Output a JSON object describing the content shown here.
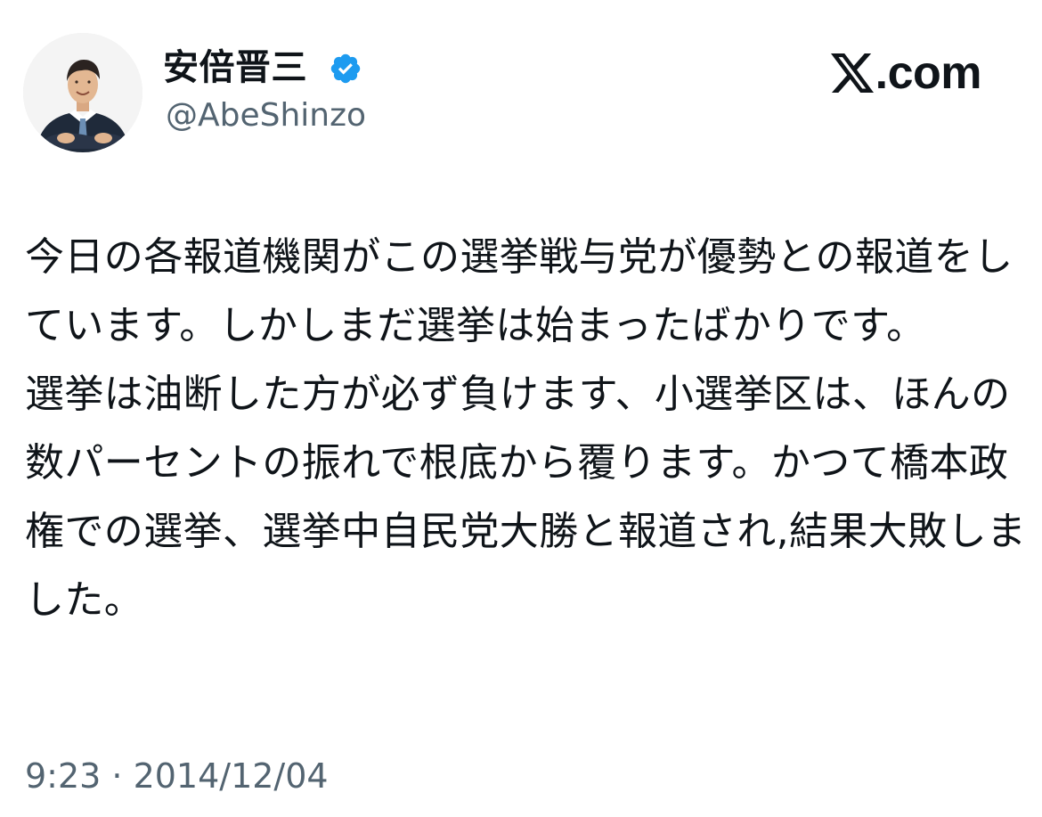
{
  "author": {
    "display_name": "安倍晋三",
    "handle": "@AbeShinzo",
    "verified": true,
    "avatar_icon": "profile-photo"
  },
  "brand": {
    "logo_icon": "x-logo-icon",
    "site_text": ".com"
  },
  "tweet": {
    "text": "今日の各報道機関がこの選挙戦与党が優勢との報道をしています。しかしまだ選挙は始まったばかりです。\n選挙は油断した方が必ず負けます、小選挙区は、ほんの数パーセントの振れで根底から覆ります。かつて橋本政権での選挙、選挙中自民党大勝と報道され,結果大敗しました。",
    "timestamp": "9:23 · 2014/12/04"
  },
  "colors": {
    "text": "#0f1419",
    "secondary_text": "#536471",
    "verified_badge": "#1d9bf0",
    "background": "#ffffff"
  }
}
